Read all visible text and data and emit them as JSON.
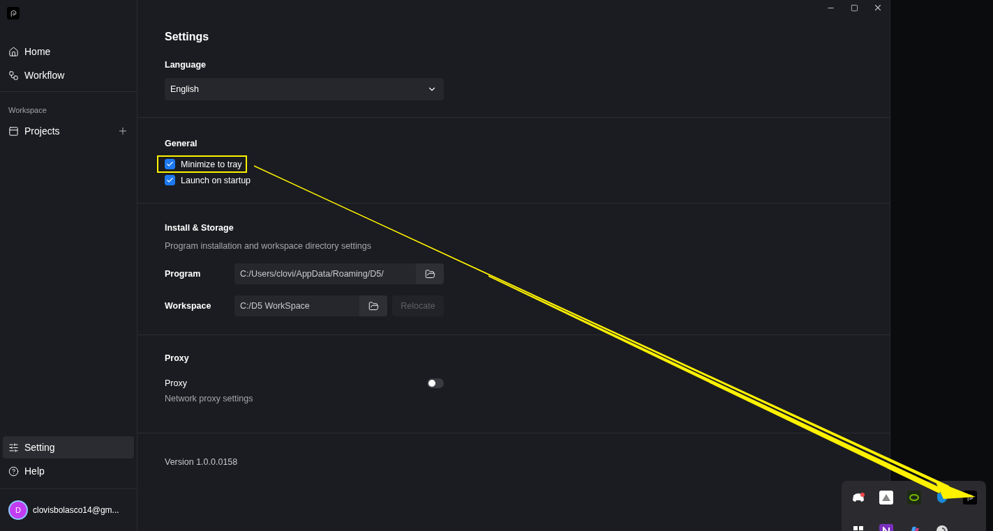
{
  "sidebar": {
    "nav": [
      {
        "label": "Home",
        "selected": false
      },
      {
        "label": "Workflow",
        "selected": false
      }
    ],
    "workspace_label": "Workspace",
    "workspace_items": [
      {
        "label": "Projects",
        "selected": false
      }
    ],
    "bottom": [
      {
        "label": "Setting",
        "selected": true
      },
      {
        "label": "Help",
        "selected": false
      }
    ],
    "user": {
      "initial": "D",
      "email": "clovisbolasco14@gm..."
    }
  },
  "title": "Settings",
  "language": {
    "label": "Language",
    "value": "English"
  },
  "general": {
    "title": "General",
    "options": [
      {
        "label": "Minimize to tray",
        "checked": true,
        "highlighted": true
      },
      {
        "label": "Launch on startup",
        "checked": true,
        "highlighted": false
      }
    ]
  },
  "install": {
    "title": "Install & Storage",
    "description": "Program installation and workspace directory settings",
    "rows": [
      {
        "label": "Program",
        "value": "C:/Users/clovi/AppData/Roaming/D5/",
        "relocate": null
      },
      {
        "label": "Workspace",
        "value": "C:/D5 WorkSpace",
        "relocate": {
          "label": "Relocate",
          "disabled": true
        }
      }
    ]
  },
  "proxy": {
    "title": "Proxy",
    "label": "Proxy",
    "on": false,
    "description": "Network proxy settings"
  },
  "version": "Version 1.0.0.0158"
}
